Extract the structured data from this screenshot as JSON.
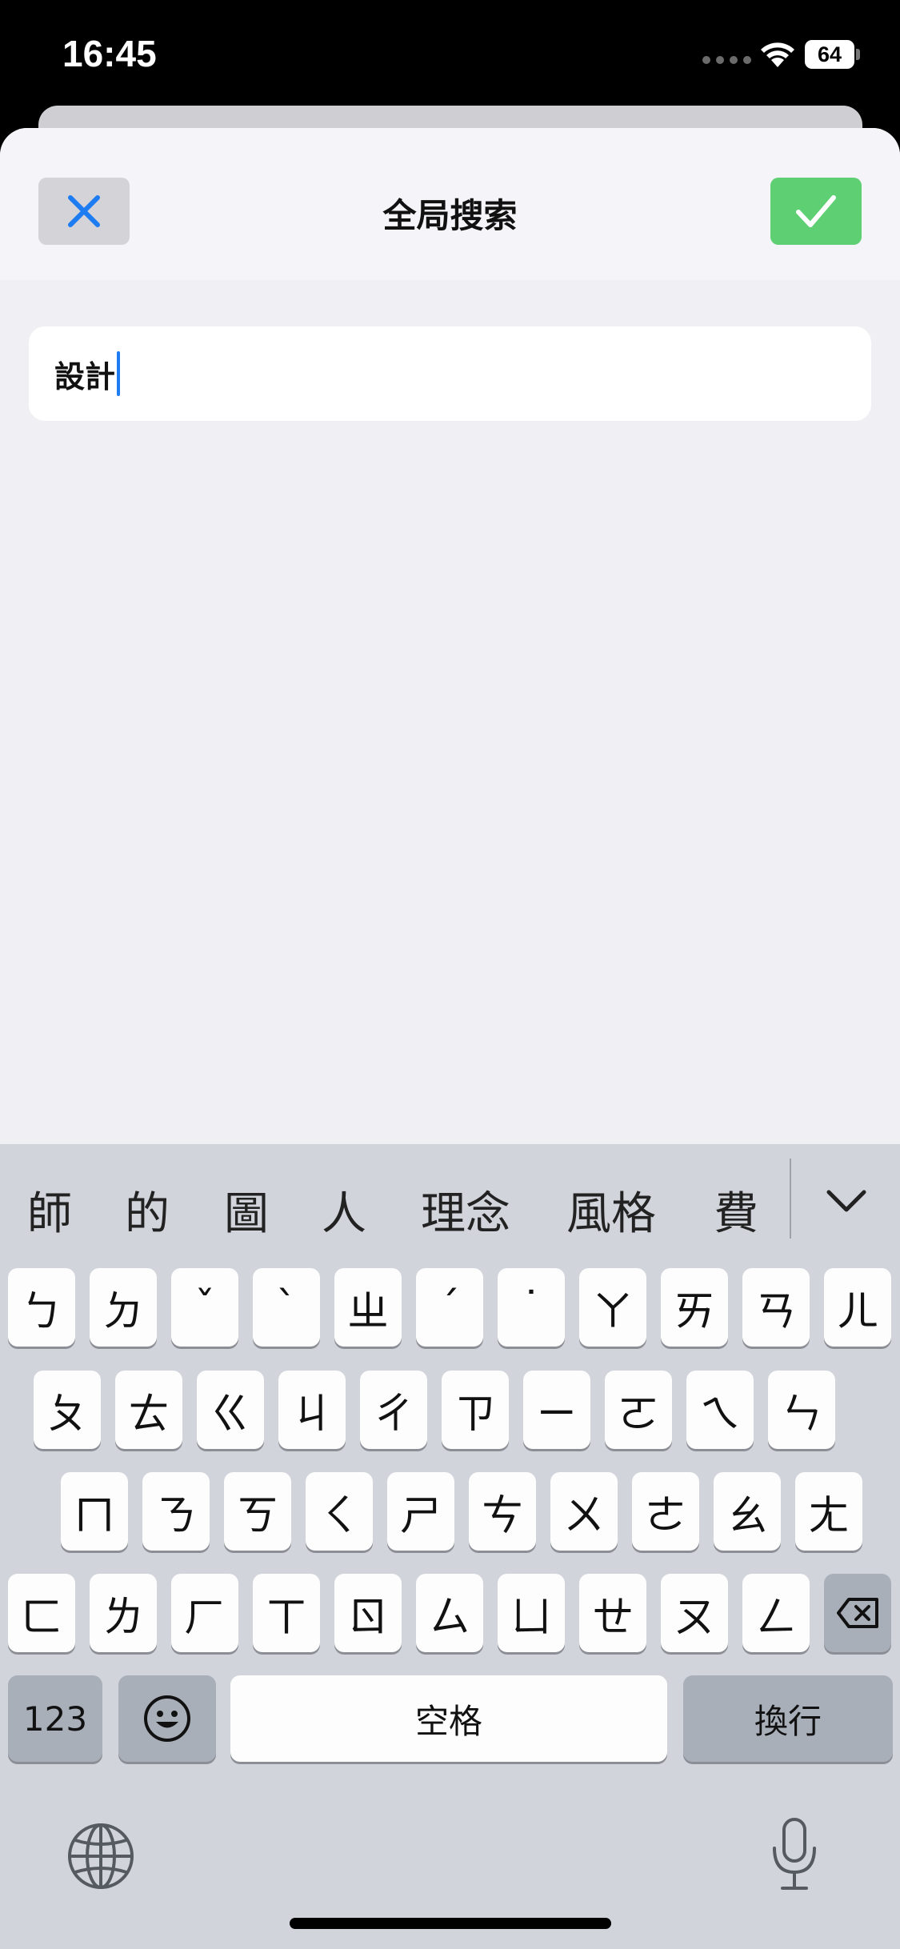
{
  "status": {
    "time": "16:45",
    "battery": "64"
  },
  "nav": {
    "title": "全局搜索",
    "close_icon": "close-x-icon",
    "confirm_icon": "checkmark-icon",
    "accent": "#1e7cf2",
    "confirm_color": "#5fcf73"
  },
  "search": {
    "value": "設計"
  },
  "keyboard": {
    "candidates": [
      "師",
      "的",
      "圖",
      "人",
      "理念",
      "風格",
      "費"
    ],
    "row1": [
      "ㄅ",
      "ㄉ",
      "ˇ",
      "ˋ",
      "ㄓ",
      "ˊ",
      "˙",
      "ㄚ",
      "ㄞ",
      "ㄢ",
      "ㄦ"
    ],
    "row2": [
      "ㄆ",
      "ㄊ",
      "ㄍ",
      "ㄐ",
      "ㄔ",
      "ㄗ",
      "ㄧ",
      "ㄛ",
      "ㄟ",
      "ㄣ"
    ],
    "row3": [
      "ㄇ",
      "ㄋ",
      "ㄎ",
      "ㄑ",
      "ㄕ",
      "ㄘ",
      "ㄨ",
      "ㄜ",
      "ㄠ",
      "ㄤ"
    ],
    "row4": [
      "ㄈ",
      "ㄌ",
      "ㄏ",
      "ㄒ",
      "ㄖ",
      "ㄙ",
      "ㄩ",
      "ㄝ",
      "ㄡ",
      "ㄥ"
    ],
    "numbers_label": "123",
    "space_label": "空格",
    "return_label": "換行"
  }
}
